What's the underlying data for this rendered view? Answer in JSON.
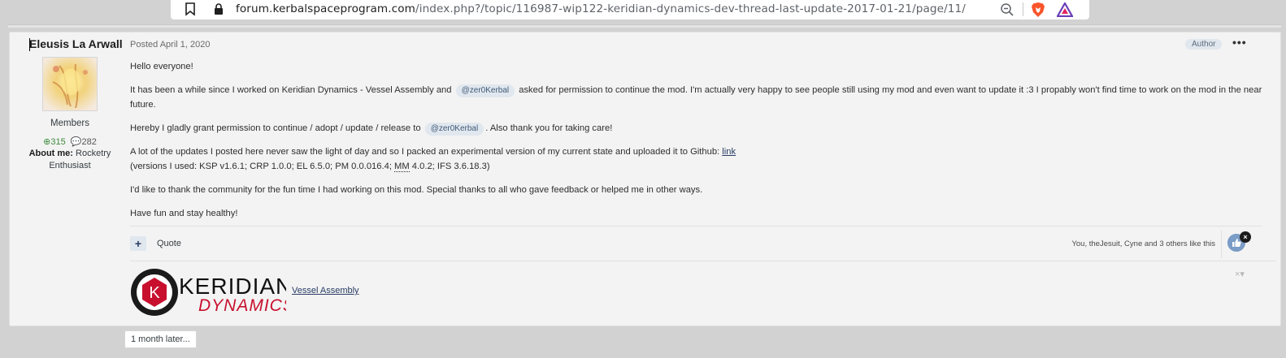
{
  "browser": {
    "url_host": "forum.kerbalspaceprogram.com",
    "url_path": "/index.php?/topic/116987-wip122-keridian-dynamics-dev-thread-last-update-2017-01-21/page/11/"
  },
  "post": {
    "author_name": "Eleusis La Arwall",
    "rank": "Members",
    "reputation": "315",
    "post_count": "282",
    "about_label": "About me:",
    "about_value": "Rocketry Enthusiast",
    "posted": "Posted April 1, 2020",
    "author_badge": "Author",
    "more_label": "•••",
    "paragraphs": {
      "p1": "Hello everyone!",
      "p2a": "It has been a while since I worked on Keridian Dynamics - Vessel Assembly and",
      "p2_mention": "@zer0Kerbal",
      "p2b": "asked for permission to continue the mod. I'm actually very happy to see people still using my mod and even want to update it :3 I propably won't find time to work on the mod in the near future.",
      "p3a": "Hereby I gladly grant permission to continue / adopt / update / release to",
      "p3_mention": "@zer0Kerbal",
      "p3b": ". Also thank you for taking care!",
      "p4a": "A lot of the updates I posted here never saw the light of day and so I packed an experimental version of my current state and uploaded it to Github:",
      "p4_link": "link",
      "p4b_pre": "(versions I used: KSP v1.6.1; CRP 1.0.0; EL 6.5.0; PM 0.0.016.4;",
      "p4b_abbr": "MM",
      "p4b_post": "4.0.2; IFS 3.6.18.3)",
      "p5": "I'd like to thank the community for the fun time I had working on this mod. Special thanks to all who gave feedback or helped me in other ways.",
      "p6": "Have fun and stay healthy!"
    },
    "footer": {
      "plus_label": "+",
      "quote_label": "Quote",
      "likes_text": "You, theJesuit, Cyne and 3 others like this",
      "like_close": "×"
    },
    "signature": {
      "logo_text_1": "KERIDIAN",
      "logo_text_2": "DYNAMICS",
      "logo_letter": "K",
      "link_text": "Vessel Assembly",
      "close_label": "×▾"
    }
  },
  "time_separator": "1 month later...",
  "colors": {
    "accent": "#283c64",
    "badge_bg": "#e1e7ee",
    "logo_red": "#c8102e"
  }
}
